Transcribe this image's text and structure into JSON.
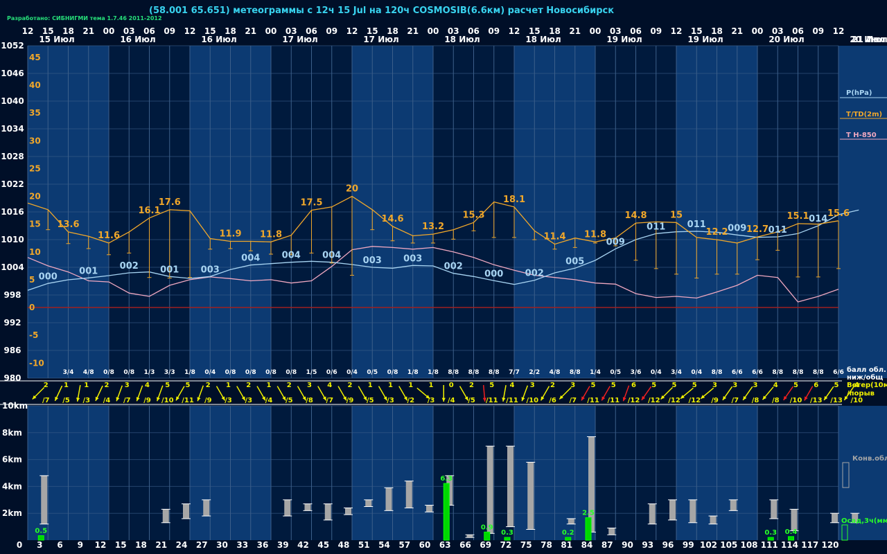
{
  "header": {
    "title": "(58.001 65.651) метеограммы с  12ч 15 Jul на 120ч COSMOSIB(6.6км) расчет Новосибирск",
    "credit": "Разработано: СИБНИГМИ тема 1.7.46 2011-2012"
  },
  "legend": {
    "pressure": "P(hPa)",
    "temperature": "T/TD(2m)",
    "t850": "T H-850",
    "clouds_label": "балл обл.",
    "clouds_label2": "ниж/общ",
    "wind_label": "Ветер(10м)",
    "wind_label2": "/порыв",
    "conv": "Конв.обл.",
    "precip": "Осад,3ч(мм)"
  },
  "colors": {
    "background": "#000f28",
    "band_dark": "#001a3d",
    "band_light": "#0c3a72",
    "grid": "#3c5f8a",
    "pressure": "#a8d4f2",
    "temperature": "#f0a72a",
    "t850": "#f0a8c0",
    "wind_normal": "#f0f000",
    "wind_strong": "#f02020",
    "precip": "#00d800",
    "conv": "#a6a6a6",
    "zero_line": "#a02020"
  },
  "chart_data": {
    "type": "line",
    "hour_ticks": [
      "12",
      "15",
      "18",
      "21",
      "00",
      "03",
      "06",
      "09",
      "12",
      "15",
      "18",
      "21",
      "00",
      "03",
      "06",
      "09",
      "12",
      "15",
      "18",
      "21",
      "00",
      "03",
      "06",
      "09",
      "12",
      "15",
      "18",
      "21",
      "00",
      "03",
      "06",
      "09",
      "12",
      "15",
      "18",
      "21",
      "00",
      "03",
      "06",
      "09",
      "12"
    ],
    "day_labels": [
      "15 Июл",
      "16 Июл",
      "16 Июл",
      "17 Июл",
      "17 Июл",
      "18 Июл",
      "18 Июл",
      "19 Июл",
      "19 Июл",
      "20 Июл",
      "20 Июл",
      "21 Июл"
    ],
    "step_labels": [
      "0",
      "3",
      "6",
      "9",
      "12",
      "15",
      "18",
      "21",
      "24",
      "27",
      "30",
      "33",
      "36",
      "39",
      "42",
      "45",
      "48",
      "51",
      "54",
      "57",
      "60",
      "63",
      "66",
      "69",
      "72",
      "75",
      "78",
      "81",
      "84",
      "87",
      "90",
      "93",
      "96",
      "99",
      "102",
      "105",
      "108",
      "111",
      "114",
      "117",
      "120"
    ],
    "pressure_axis_ticks": [
      "1052",
      "1046",
      "1040",
      "1034",
      "1028",
      "1022",
      "1016",
      "1010",
      "1004",
      "998",
      "992",
      "986",
      "980"
    ],
    "pressure_range": [
      980,
      1052
    ],
    "temperature_axis_ticks": [
      "45",
      "40",
      "35",
      "30",
      "25",
      "20",
      "15",
      "10",
      "5",
      "0",
      "-5",
      "-10"
    ],
    "temperature_range": [
      -12.7,
      47.1
    ],
    "height_axis_ticks": [
      "10km",
      "8km",
      "6km",
      "4km",
      "2km"
    ],
    "height_range": [
      0,
      10
    ],
    "series": [
      {
        "name": "P(hPa)",
        "values": [
          999,
          1000.5,
          1001.3,
          1001.7,
          1002.2,
          1002.8,
          1003,
          1002,
          1001.6,
          1002,
          1003.5,
          1004.5,
          1004.8,
          1005.1,
          1005.3,
          1005.1,
          1004.6,
          1004,
          1003.8,
          1004.4,
          1004.3,
          1002.7,
          1002,
          1001.1,
          1000.3,
          1001.2,
          1002.8,
          1003.8,
          1005.5,
          1008,
          1010,
          1011.3,
          1011.7,
          1011.8,
          1011.6,
          1011,
          1010.5,
          1010.6,
          1011.3,
          1013,
          1015.4,
          1016.4
        ]
      },
      {
        "name": "T/TD(2m)",
        "values": [
          18.8,
          17.6,
          13.6,
          12.8,
          11.6,
          13.6,
          16.1,
          17.6,
          17.4,
          12.4,
          11.9,
          11.9,
          11.8,
          13,
          17.5,
          18.1,
          20,
          17.6,
          14.6,
          12.9,
          13.2,
          14,
          15.3,
          19,
          18.1,
          13.8,
          11.4,
          12.5,
          11.8,
          12.5,
          15.2,
          15.4,
          15.3,
          12.6,
          12.2,
          11.6,
          12.7,
          13.6,
          15.1,
          15.0,
          15.6
        ]
      },
      {
        "name": "TD",
        "values": [
          15.5,
          14,
          11.5,
          10.6,
          9.5,
          9.8,
          5.4,
          5.3,
          5.4,
          10.5,
          10.6,
          10.2,
          9.6,
          9.5,
          9.8,
          8,
          5.8,
          14,
          12,
          11.6,
          11.6,
          12.3,
          13.8,
          12.6,
          12.6,
          12.2,
          10.5,
          10.8,
          11.6,
          11.1,
          8.5,
          7.0,
          6.0,
          5.3,
          6.0,
          6.0,
          8.6,
          10.3,
          5.5,
          5.5,
          7.0
        ]
      },
      {
        "name": "T H-850",
        "values": [
          9,
          7.5,
          6.4,
          4.8,
          4.6,
          2.6,
          2,
          4,
          5,
          5.5,
          5.2,
          4.8,
          5,
          4.4,
          4.8,
          7.4,
          10.4,
          11,
          10.8,
          10.5,
          10.8,
          10,
          9,
          7.7,
          6.7,
          5.8,
          5.4,
          5,
          4.4,
          4.2,
          2.5,
          1.8,
          2,
          1.7,
          2.8,
          4,
          5.8,
          5.4,
          1,
          2,
          3.3
        ]
      },
      {
        "name": "Осад,3ч(мм)",
        "values": [
          0,
          0.5,
          0,
          0,
          0,
          0,
          0,
          0,
          0,
          0,
          0,
          0,
          0,
          0,
          0,
          0,
          0,
          0,
          0,
          0,
          0,
          6.3,
          0,
          0.9,
          0.3,
          0,
          0,
          0.2,
          2.5,
          0,
          0,
          0,
          0,
          0,
          0,
          0,
          0,
          0.3,
          0.4,
          0,
          0
        ]
      }
    ],
    "temperature_labels": [
      {
        "i": 2,
        "text": "13.6"
      },
      {
        "i": 4,
        "text": "11.6"
      },
      {
        "i": 6,
        "text": "16.1"
      },
      {
        "i": 7,
        "text": "17.6"
      },
      {
        "i": 10,
        "text": "11.9"
      },
      {
        "i": 12,
        "text": "11.8"
      },
      {
        "i": 14,
        "text": "17.5"
      },
      {
        "i": 16,
        "text": "20"
      },
      {
        "i": 18,
        "text": "14.6"
      },
      {
        "i": 20,
        "text": "13.2"
      },
      {
        "i": 22,
        "text": "15.3"
      },
      {
        "i": 24,
        "text": "18.1"
      },
      {
        "i": 26,
        "text": "11.4"
      },
      {
        "i": 28,
        "text": "11.8"
      },
      {
        "i": 30,
        "text": "14.8"
      },
      {
        "i": 32,
        "text": "15"
      },
      {
        "i": 34,
        "text": "12.2"
      },
      {
        "i": 36,
        "text": "12.7"
      },
      {
        "i": 38,
        "text": "15.1"
      },
      {
        "i": 40,
        "text": "15.6"
      }
    ],
    "pressure_labels": [
      {
        "i": 1,
        "text": "000"
      },
      {
        "i": 3,
        "text": "001"
      },
      {
        "i": 5,
        "text": "002"
      },
      {
        "i": 7,
        "text": "001"
      },
      {
        "i": 9,
        "text": "003"
      },
      {
        "i": 11,
        "text": "004"
      },
      {
        "i": 13,
        "text": "004"
      },
      {
        "i": 15,
        "text": "004"
      },
      {
        "i": 17,
        "text": "003"
      },
      {
        "i": 19,
        "text": "003"
      },
      {
        "i": 21,
        "text": "002"
      },
      {
        "i": 23,
        "text": "000"
      },
      {
        "i": 25,
        "text": "002"
      },
      {
        "i": 27,
        "text": "005"
      },
      {
        "i": 29,
        "text": "009"
      },
      {
        "i": 31,
        "text": "011"
      },
      {
        "i": 33,
        "text": "011"
      },
      {
        "i": 35,
        "text": "009"
      },
      {
        "i": 37,
        "text": "011"
      },
      {
        "i": 39,
        "text": "014"
      }
    ],
    "precip_labels": [
      {
        "i": 1,
        "text": "0.5"
      },
      {
        "i": 21,
        "text": "6.3"
      },
      {
        "i": 23,
        "text": "0.9"
      },
      {
        "i": 24,
        "text": "0.3"
      },
      {
        "i": 27,
        "text": "0.2"
      },
      {
        "i": 28,
        "text": "2.5"
      },
      {
        "i": 37,
        "text": "0.3"
      },
      {
        "i": 38,
        "text": "0.4"
      }
    ],
    "cloud_cover": [
      "3/4",
      "4/8",
      "0/8",
      "0/8",
      "1/3",
      "3/3",
      "1/8",
      "0/4",
      "0/8",
      "0/8",
      "0/8",
      "0/8",
      "1/5",
      "0/6",
      "0/4",
      "0/5",
      "0/8",
      "1/8",
      "1/8",
      "8/8",
      "8/8",
      "8/8",
      "7/7",
      "2/2",
      "4/8",
      "8/8",
      "1/4",
      "0/5",
      "3/6",
      "0/4",
      "3/4",
      "0/4",
      "8/8",
      "6/6",
      "6/6",
      "8/8",
      "8/8",
      "8/8",
      "6/6"
    ],
    "wind": [
      {
        "i": 1,
        "speed": "2",
        "gust": "/7",
        "dir": 135,
        "strong": false
      },
      {
        "i": 2,
        "speed": "1",
        "gust": "/5",
        "dir": 115,
        "strong": false
      },
      {
        "i": 3,
        "speed": "1",
        "gust": "/3",
        "dir": 100,
        "strong": false
      },
      {
        "i": 4,
        "speed": "2",
        "gust": "/4",
        "dir": 115,
        "strong": false
      },
      {
        "i": 5,
        "speed": "3",
        "gust": "/7",
        "dir": 110,
        "strong": false
      },
      {
        "i": 6,
        "speed": "4",
        "gust": "/9",
        "dir": 110,
        "strong": false
      },
      {
        "i": 7,
        "speed": "5",
        "gust": "/10",
        "dir": 110,
        "strong": false
      },
      {
        "i": 8,
        "speed": "5",
        "gust": "/11",
        "dir": 120,
        "strong": false
      },
      {
        "i": 9,
        "speed": "2",
        "gust": "/9",
        "dir": 110,
        "strong": false
      },
      {
        "i": 10,
        "speed": "1",
        "gust": "/3",
        "dir": 60,
        "strong": false
      },
      {
        "i": 11,
        "speed": "2",
        "gust": "/3",
        "dir": 60,
        "strong": false
      },
      {
        "i": 12,
        "speed": "1",
        "gust": "/4",
        "dir": 60,
        "strong": false
      },
      {
        "i": 13,
        "speed": "2",
        "gust": "/5",
        "dir": 60,
        "strong": false
      },
      {
        "i": 14,
        "speed": "3",
        "gust": "/8",
        "dir": 60,
        "strong": false
      },
      {
        "i": 15,
        "speed": "4",
        "gust": "/7",
        "dir": 60,
        "strong": false
      },
      {
        "i": 16,
        "speed": "2",
        "gust": "/9",
        "dir": 60,
        "strong": false
      },
      {
        "i": 17,
        "speed": "1",
        "gust": "/5",
        "dir": 60,
        "strong": false
      },
      {
        "i": 18,
        "speed": "1",
        "gust": "/3",
        "dir": 60,
        "strong": false
      },
      {
        "i": 19,
        "speed": "1",
        "gust": "/2",
        "dir": 60,
        "strong": false
      },
      {
        "i": 20,
        "speed": "1",
        "gust": "/3",
        "dir": 40,
        "strong": false
      },
      {
        "i": 21,
        "speed": "0",
        "gust": "/4",
        "dir": 90,
        "strong": false
      },
      {
        "i": 22,
        "speed": "2",
        "gust": "/5",
        "dir": 60,
        "strong": false
      },
      {
        "i": 23,
        "speed": "5",
        "gust": "/11",
        "dir": 85,
        "strong": true
      },
      {
        "i": 24,
        "speed": "4",
        "gust": "/11",
        "dir": 100,
        "strong": false
      },
      {
        "i": 25,
        "speed": "3",
        "gust": "/10",
        "dir": 110,
        "strong": false
      },
      {
        "i": 26,
        "speed": "2",
        "gust": "/6",
        "dir": 120,
        "strong": false
      },
      {
        "i": 27,
        "speed": "3",
        "gust": "/7",
        "dir": 135,
        "strong": false
      },
      {
        "i": 28,
        "speed": "5",
        "gust": "/11",
        "dir": 120,
        "strong": true
      },
      {
        "i": 29,
        "speed": "5",
        "gust": "/11",
        "dir": 120,
        "strong": true
      },
      {
        "i": 30,
        "speed": "6",
        "gust": "/12",
        "dir": 110,
        "strong": true
      },
      {
        "i": 31,
        "speed": "5",
        "gust": "/12",
        "dir": 125,
        "strong": true
      },
      {
        "i": 32,
        "speed": "5",
        "gust": "/12",
        "dir": 135,
        "strong": false
      },
      {
        "i": 33,
        "speed": "5",
        "gust": "/12",
        "dir": 140,
        "strong": false
      },
      {
        "i": 34,
        "speed": "3",
        "gust": "/9",
        "dir": 140,
        "strong": false
      },
      {
        "i": 35,
        "speed": "3",
        "gust": "/7",
        "dir": 125,
        "strong": false
      },
      {
        "i": 36,
        "speed": "3",
        "gust": "/8",
        "dir": 125,
        "strong": false
      },
      {
        "i": 37,
        "speed": "4",
        "gust": "/8",
        "dir": 130,
        "strong": false
      },
      {
        "i": 38,
        "speed": "5",
        "gust": "/10",
        "dir": 125,
        "strong": true
      },
      {
        "i": 39,
        "speed": "6",
        "gust": "/13",
        "dir": 120,
        "strong": true
      },
      {
        "i": 40,
        "speed": "5",
        "gust": "/13",
        "dir": 125,
        "strong": false
      },
      {
        "i": 41,
        "speed": "4",
        "gust": "/10",
        "dir": 125,
        "strong": false
      }
    ],
    "convective_clouds": [
      {
        "i": 1,
        "base": 1.2,
        "top": 4.8
      },
      {
        "i": 7,
        "base": 1.3,
        "top": 2.3
      },
      {
        "i": 8,
        "base": 1.6,
        "top": 2.7
      },
      {
        "i": 9,
        "base": 1.8,
        "top": 3.0
      },
      {
        "i": 13,
        "base": 1.8,
        "top": 3.0
      },
      {
        "i": 14,
        "base": 2.2,
        "top": 2.7
      },
      {
        "i": 15,
        "base": 1.5,
        "top": 2.7
      },
      {
        "i": 16,
        "base": 1.9,
        "top": 2.4
      },
      {
        "i": 17,
        "base": 2.5,
        "top": 3.0
      },
      {
        "i": 18,
        "base": 2.2,
        "top": 3.9
      },
      {
        "i": 19,
        "base": 2.4,
        "top": 4.4
      },
      {
        "i": 20,
        "base": 2.1,
        "top": 2.6
      },
      {
        "i": 21,
        "base": 2.6,
        "top": 4.8
      },
      {
        "i": 22,
        "base": 0.2,
        "top": 0.4
      },
      {
        "i": 23,
        "base": 0.5,
        "top": 7.0
      },
      {
        "i": 24,
        "base": 1.0,
        "top": 7.0
      },
      {
        "i": 25,
        "base": 0.8,
        "top": 5.8
      },
      {
        "i": 27,
        "base": 1.2,
        "top": 1.6
      },
      {
        "i": 28,
        "base": 0.6,
        "top": 7.7
      },
      {
        "i": 29,
        "base": 0.4,
        "top": 0.9
      },
      {
        "i": 31,
        "base": 1.2,
        "top": 2.7
      },
      {
        "i": 32,
        "base": 1.5,
        "top": 3.0
      },
      {
        "i": 33,
        "base": 1.3,
        "top": 3.0
      },
      {
        "i": 34,
        "base": 1.2,
        "top": 1.8
      },
      {
        "i": 35,
        "base": 2.2,
        "top": 3.0
      },
      {
        "i": 37,
        "base": 1.6,
        "top": 3.0
      },
      {
        "i": 38,
        "base": 0.7,
        "top": 2.3
      },
      {
        "i": 40,
        "base": 1.3,
        "top": 2.0
      },
      {
        "i": 41,
        "base": 1.3,
        "top": 2.0
      }
    ]
  }
}
